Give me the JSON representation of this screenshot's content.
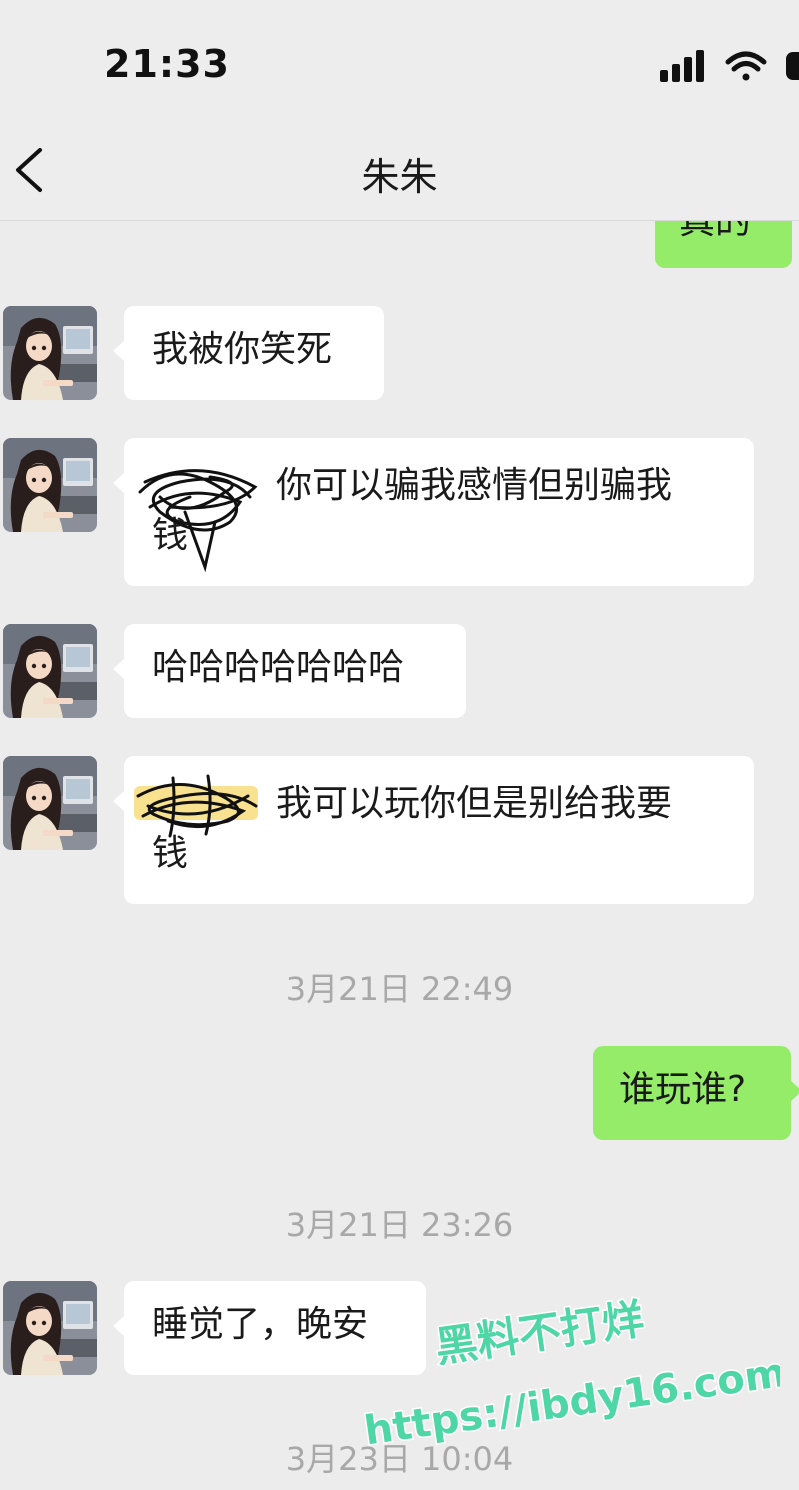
{
  "status_bar": {
    "time": "21:33",
    "signal_icon": "signal-bars-icon",
    "wifi_icon": "wifi-icon",
    "battery_icon": "battery-icon"
  },
  "header": {
    "back_icon": "chevron-left-icon",
    "title": "朱朱"
  },
  "messages": [
    {
      "from": "self",
      "text": "真的"
    },
    {
      "from": "contact",
      "text": "我被你笑死"
    },
    {
      "from": "contact",
      "text_line1": "你可以骗我感情但别骗我",
      "text_line2": "钱"
    },
    {
      "from": "contact",
      "text": "哈哈哈哈哈哈哈"
    },
    {
      "from": "contact",
      "text_line1": "我可以玩你但是别给我要",
      "text_line2": "钱"
    },
    {
      "timestamp": "3月21日 22:49"
    },
    {
      "from": "self",
      "text": "谁玩谁?"
    },
    {
      "timestamp": "3月21日 23:26"
    },
    {
      "from": "contact",
      "text": "睡觉了，晚安"
    },
    {
      "timestamp": "3月23日 10:04"
    }
  ],
  "watermark": {
    "line1": "黑料不打烊",
    "line2": "https://ibdy16.com"
  },
  "colors": {
    "background": "#ececec",
    "outgoing_bubble": "#95ec69",
    "incoming_bubble": "#ffffff",
    "timestamp_text": "#a8a8a8",
    "watermark_fill": "#4fd6a6"
  }
}
